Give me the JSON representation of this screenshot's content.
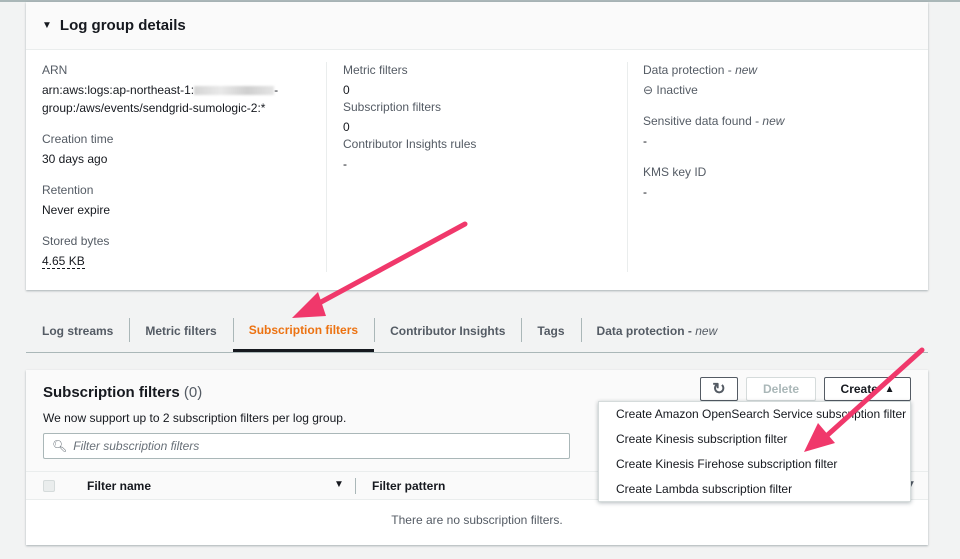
{
  "details": {
    "title": "Log group details",
    "arn_label": "ARN",
    "arn_line1": "arn:aws:logs:ap-northeast-1:",
    "arn_line1_end": "-",
    "arn_line2": "group:/aws/events/sendgrid-sumologic-2:*",
    "creation_label": "Creation time",
    "creation_value": "30 days ago",
    "retention_label": "Retention",
    "retention_value": "Never expire",
    "stored_label": "Stored bytes",
    "stored_value": "4.65 KB",
    "metric_label": "Metric filters",
    "metric_value": "0",
    "subs_label": "Subscription filters",
    "subs_value": "0",
    "ci_label": "Contributor Insights rules",
    "ci_value": "-",
    "dp_label": "Data protection",
    "new": "new",
    "dp_value": "Inactive",
    "sens_label": "Sensitive data found",
    "sens_value": "-",
    "kms_label": "KMS key ID",
    "kms_value": "-"
  },
  "tabs": [
    {
      "label": "Log streams"
    },
    {
      "label": "Metric filters"
    },
    {
      "label": "Subscription filters"
    },
    {
      "label": "Contributor Insights"
    },
    {
      "label": "Tags"
    },
    {
      "label": "Data protection",
      "suffix": "new"
    }
  ],
  "subs": {
    "title": "Subscription filters",
    "count": "(0)",
    "desc": "We now support up to 2 subscription filters per log group.",
    "search_placeholder": "Filter subscription filters",
    "refresh": "↻",
    "delete": "Delete",
    "create": "Create",
    "create_caret": "▲",
    "col_name": "Filter name",
    "col_pattern": "Filter pattern",
    "empty": "There are no subscription filters."
  },
  "menu": [
    "Create Amazon OpenSearch Service subscription filter",
    "Create Kinesis subscription filter",
    "Create Kinesis Firehose subscription filter",
    "Create Lambda subscription filter"
  ],
  "colors": {
    "accent": "#ec7211",
    "annotation": "#f0386b"
  }
}
